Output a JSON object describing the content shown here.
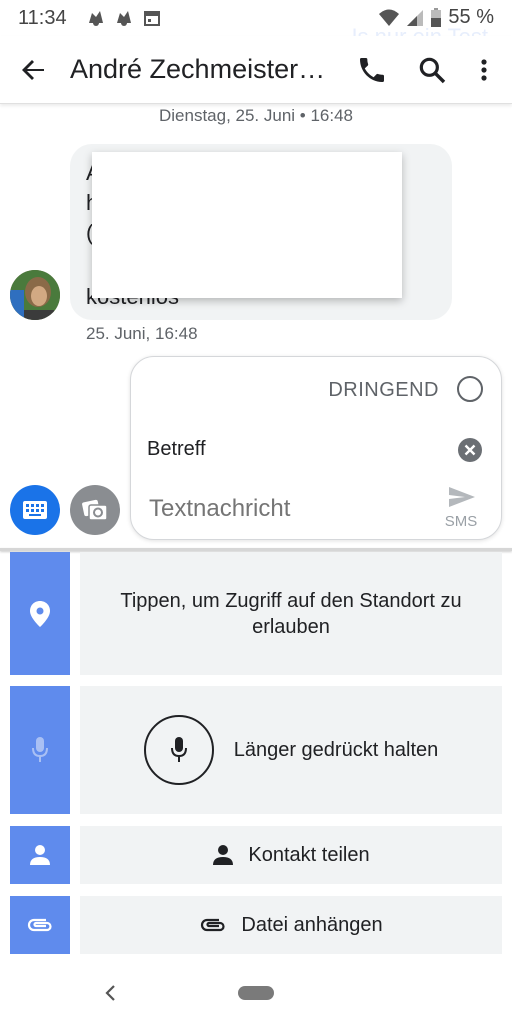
{
  "status_bar": {
    "time": "11:34",
    "battery_pct": "55 %",
    "ghost_text": "Is nur ein Test",
    "icons": [
      "notification-icon",
      "notification-icon",
      "calendar-icon",
      "wifi-icon",
      "signal-icon",
      "battery-icon"
    ]
  },
  "app_bar": {
    "title": "André Zechmeister…",
    "icons": [
      "back-arrow-icon",
      "phone-icon",
      "search-icon",
      "more-vert-icon"
    ]
  },
  "conversation": {
    "date_separator": "Dienstag, 25. Juni • 16:48",
    "message": {
      "line1": "A",
      "line2": "h",
      "line3": "(",
      "line4": "kostenlos",
      "time": "25. Juni, 16:48"
    }
  },
  "composer": {
    "urgent_label": "DRINGEND",
    "subject_value": "Betreff",
    "message_placeholder": "Textnachricht",
    "send_label": "SMS"
  },
  "attach_panel": {
    "location_text": "Tippen, um Zugriff auf den Standort zu erlauben",
    "audio_text": "Länger gedrückt halten",
    "contact_text": "Kontakt teilen",
    "file_text": "Datei anhängen"
  },
  "colors": {
    "accent": "#1a73e8",
    "tile_blue": "#5f8bed",
    "tile_bg": "#f1f3f4"
  }
}
